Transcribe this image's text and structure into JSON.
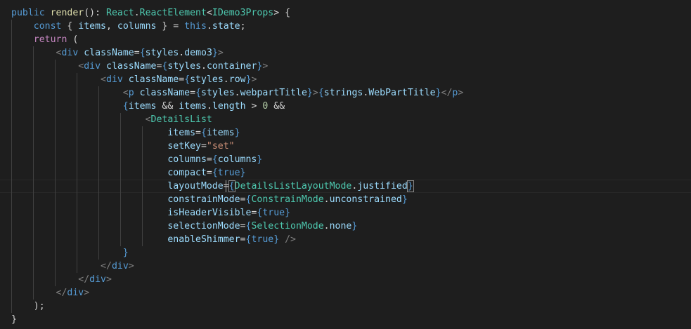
{
  "editor": {
    "theme": "dark",
    "background": "#1e1e1e",
    "lines": [
      "public render(): React.ReactElement<IDemo3Props> {",
      "    const { items, columns } = this.state;",
      "    return (",
      "        <div className={styles.demo3}>",
      "            <div className={styles.container}>",
      "                <div className={styles.row}>",
      "                    <p className={styles.webpartTitle}>{strings.WebPartTitle}</p>",
      "                    {items && items.length > 0 &&",
      "                        <DetailsList",
      "                            items={items}",
      "                            setKey=\"set\"",
      "                            columns={columns}",
      "                            compact={true}",
      "                            layoutMode={DetailsListLayoutMode.justified}",
      "                            constrainMode={ConstrainMode.unconstrained}",
      "                            isHeaderVisible={true}",
      "                            selectionMode={SelectionMode.none}",
      "                            enableShimmer={true} />",
      "                    }",
      "                </div>",
      "            </div>",
      "        </div>",
      "    );",
      "}"
    ]
  }
}
